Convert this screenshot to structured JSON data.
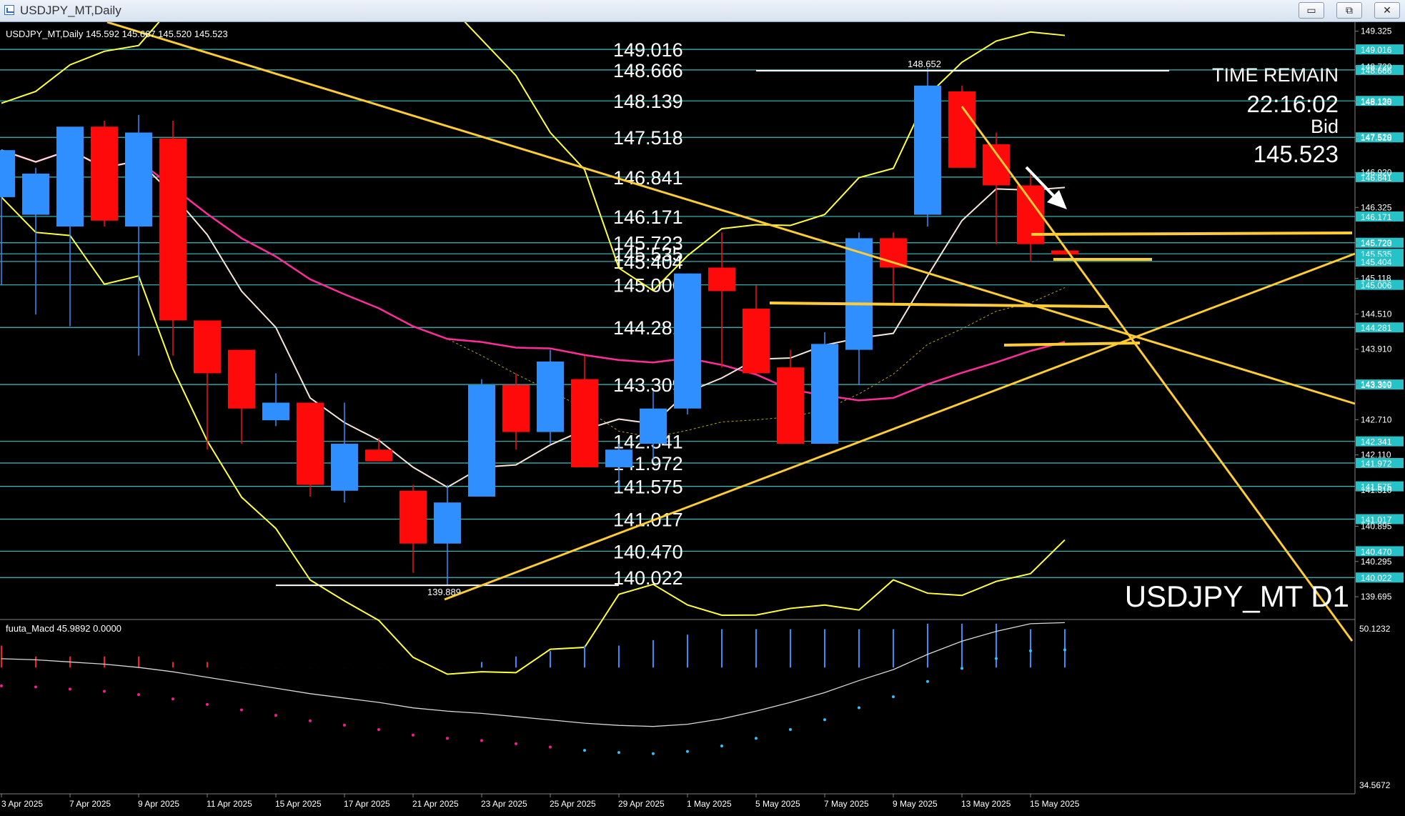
{
  "window": {
    "title": "USDJPY_MT,Daily",
    "buttons": {
      "minimize": "▭",
      "restore": "⧉",
      "close": "✕"
    }
  },
  "chart_data": {
    "type": "candlestick",
    "symbol_line": "USDJPY_MT,Daily  145.592 145.667 145.520 145.523",
    "symbol_watermark": "USDJPY_MT D1",
    "info": {
      "label": "TIME REMAIN",
      "time": "22:16:02",
      "bid_label": "Bid",
      "bid": "145.523"
    },
    "ylim": [
      139.38,
      149.48
    ],
    "y_ticks": [
      "149.325",
      "148.720",
      "148.120",
      "147.520",
      "146.920",
      "146.325",
      "145.720",
      "145.118",
      "144.510",
      "143.910",
      "143.310",
      "142.710",
      "142.110",
      "141.510",
      "140.895",
      "140.295",
      "139.695"
    ],
    "levels": [
      "149.016",
      "148.666",
      "148.139",
      "147.518",
      "146.841",
      "146.171",
      "145.723",
      "145.535",
      "145.404",
      "145.006",
      "144.281",
      "143.309",
      "142.341",
      "141.972",
      "141.575",
      "141.017",
      "140.470",
      "140.022"
    ],
    "level_label_list": [
      "149.016",
      "148.666",
      "148.139",
      "147.518",
      "146.841",
      "146.171",
      "145.723",
      "145.535",
      "145.404",
      "145.006",
      "144.281",
      "143.309",
      "142.341",
      "141.972",
      "141.575",
      "141.017",
      "140.470",
      "140.022"
    ],
    "x_labels": [
      "3 Apr 2025",
      "7 Apr 2025",
      "9 Apr 2025",
      "11 Apr 2025",
      "15 Apr 2025",
      "17 Apr 2025",
      "21 Apr 2025",
      "23 Apr 2025",
      "25 Apr 2025",
      "29 Apr 2025",
      "1 May 2025",
      "5 May 2025",
      "7 May 2025",
      "9 May 2025",
      "13 May 2025",
      "15 May 2025"
    ],
    "candles": [
      {
        "o": 146.5,
        "h": 147.3,
        "l": 145.0,
        "c": 147.3
      },
      {
        "o": 146.2,
        "h": 147.0,
        "l": 144.5,
        "c": 146.9
      },
      {
        "o": 146.0,
        "h": 147.2,
        "l": 144.3,
        "c": 147.7
      },
      {
        "o": 147.7,
        "h": 147.8,
        "l": 146.0,
        "c": 146.1
      },
      {
        "o": 146.0,
        "h": 147.9,
        "l": 143.8,
        "c": 147.6
      },
      {
        "o": 147.5,
        "h": 147.8,
        "l": 143.8,
        "c": 144.4
      },
      {
        "o": 144.4,
        "h": 144.4,
        "l": 142.2,
        "c": 143.5
      },
      {
        "o": 143.9,
        "h": 143.9,
        "l": 142.3,
        "c": 142.9
      },
      {
        "o": 142.7,
        "h": 143.5,
        "l": 142.6,
        "c": 143.0
      },
      {
        "o": 143.0,
        "h": 143.0,
        "l": 141.4,
        "c": 141.6
      },
      {
        "o": 141.5,
        "h": 143.0,
        "l": 141.3,
        "c": 142.3
      },
      {
        "o": 142.2,
        "h": 142.4,
        "l": 142.0,
        "c": 142.0
      },
      {
        "o": 141.5,
        "h": 141.6,
        "l": 140.1,
        "c": 140.6
      },
      {
        "o": 140.6,
        "h": 141.6,
        "l": 139.9,
        "c": 141.3
      },
      {
        "o": 141.4,
        "h": 143.4,
        "l": 141.4,
        "c": 143.3
      },
      {
        "o": 143.3,
        "h": 143.5,
        "l": 142.2,
        "c": 142.5
      },
      {
        "o": 142.5,
        "h": 143.9,
        "l": 142.3,
        "c": 143.7
      },
      {
        "o": 143.4,
        "h": 143.8,
        "l": 141.9,
        "c": 141.9
      },
      {
        "o": 141.9,
        "h": 142.3,
        "l": 141.5,
        "c": 142.2
      },
      {
        "o": 142.3,
        "h": 143.2,
        "l": 142.0,
        "c": 142.9
      },
      {
        "o": 142.9,
        "h": 145.2,
        "l": 142.8,
        "c": 145.2
      },
      {
        "o": 145.3,
        "h": 145.9,
        "l": 143.6,
        "c": 144.9
      },
      {
        "o": 144.6,
        "h": 145.0,
        "l": 143.5,
        "c": 143.5
      },
      {
        "o": 143.6,
        "h": 143.9,
        "l": 142.3,
        "c": 142.3
      },
      {
        "o": 142.3,
        "h": 144.2,
        "l": 142.3,
        "c": 144.0
      },
      {
        "o": 143.9,
        "h": 145.9,
        "l": 143.3,
        "c": 145.8
      },
      {
        "o": 145.8,
        "h": 145.9,
        "l": 144.7,
        "c": 145.3
      },
      {
        "o": 146.2,
        "h": 148.7,
        "l": 146.0,
        "c": 148.4
      },
      {
        "o": 148.3,
        "h": 148.4,
        "l": 147.0,
        "c": 147.0
      },
      {
        "o": 147.4,
        "h": 147.6,
        "l": 145.7,
        "c": 146.7
      },
      {
        "o": 146.7,
        "h": 146.9,
        "l": 145.4,
        "c": 145.7
      },
      {
        "o": 145.592,
        "h": 145.667,
        "l": 145.52,
        "c": 145.523
      }
    ],
    "high_marker": {
      "label": "148.652",
      "value": 148.652
    },
    "low_marker": {
      "label": "139.889",
      "value": 139.889
    },
    "macd": {
      "title": "fuuta_Macd 45.9892  0.0000",
      "top_label": "50.1232",
      "bottom_label": "34.5672",
      "ylim": [
        34.5672,
        50.1232
      ],
      "hist": [
        48,
        47,
        47,
        47,
        47,
        46.5,
        46.5,
        46,
        46,
        46,
        46,
        46,
        46,
        46,
        46.5,
        47,
        47.5,
        48,
        48,
        48.5,
        49,
        49.5,
        49.5,
        49.5,
        49.5,
        49.5,
        49.5,
        50,
        50,
        50,
        49.5,
        49.5
      ],
      "signal": [
        46.8,
        46.7,
        46.5,
        46.3,
        46.0,
        45.6,
        45.1,
        44.6,
        44.1,
        43.6,
        43.2,
        42.8,
        42.3,
        42.0,
        41.8,
        41.5,
        41.2,
        40.9,
        40.7,
        40.6,
        40.8,
        41.3,
        42.0,
        42.8,
        43.7,
        44.8,
        45.8,
        47.2,
        48.4,
        49.3,
        50.0,
        50.1
      ]
    }
  }
}
